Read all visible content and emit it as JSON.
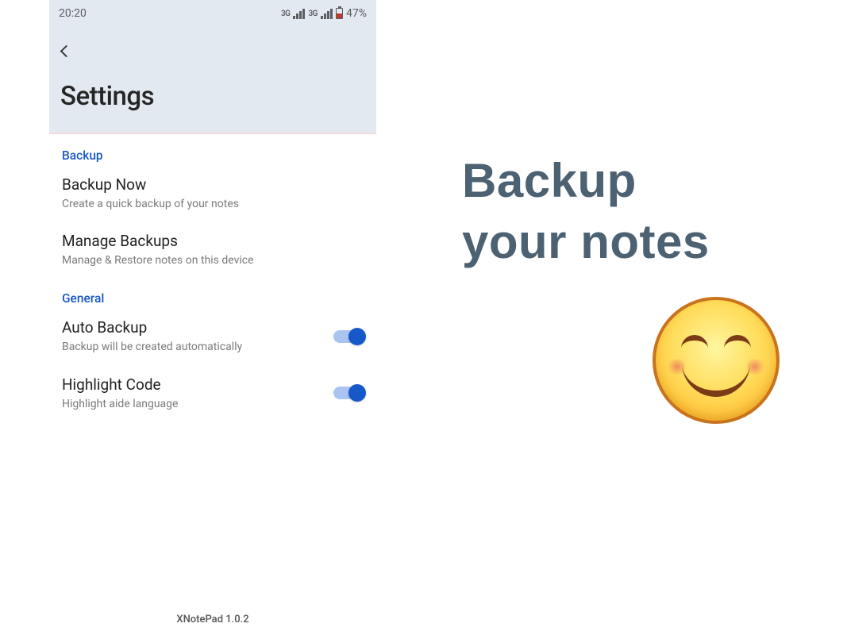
{
  "status": {
    "time": "20:20",
    "network_label": "3G",
    "battery": "47%"
  },
  "header": {
    "title": "Settings"
  },
  "sections": {
    "backup": {
      "header": "Backup",
      "backup_now": {
        "title": "Backup Now",
        "desc": "Create a quick backup of your notes"
      },
      "manage_backups": {
        "title": "Manage Backups",
        "desc": "Manage & Restore notes on this device"
      }
    },
    "general": {
      "header": "General",
      "auto_backup": {
        "title": "Auto Backup",
        "desc": "Backup will be created automatically",
        "on": true
      },
      "highlight_code": {
        "title": "Highlight Code",
        "desc": "Highlight aide language",
        "on": true
      }
    }
  },
  "footer": {
    "app_version": "XNotePad 1.0.2"
  },
  "promo": {
    "line1": "Backup",
    "line2": "your notes"
  }
}
